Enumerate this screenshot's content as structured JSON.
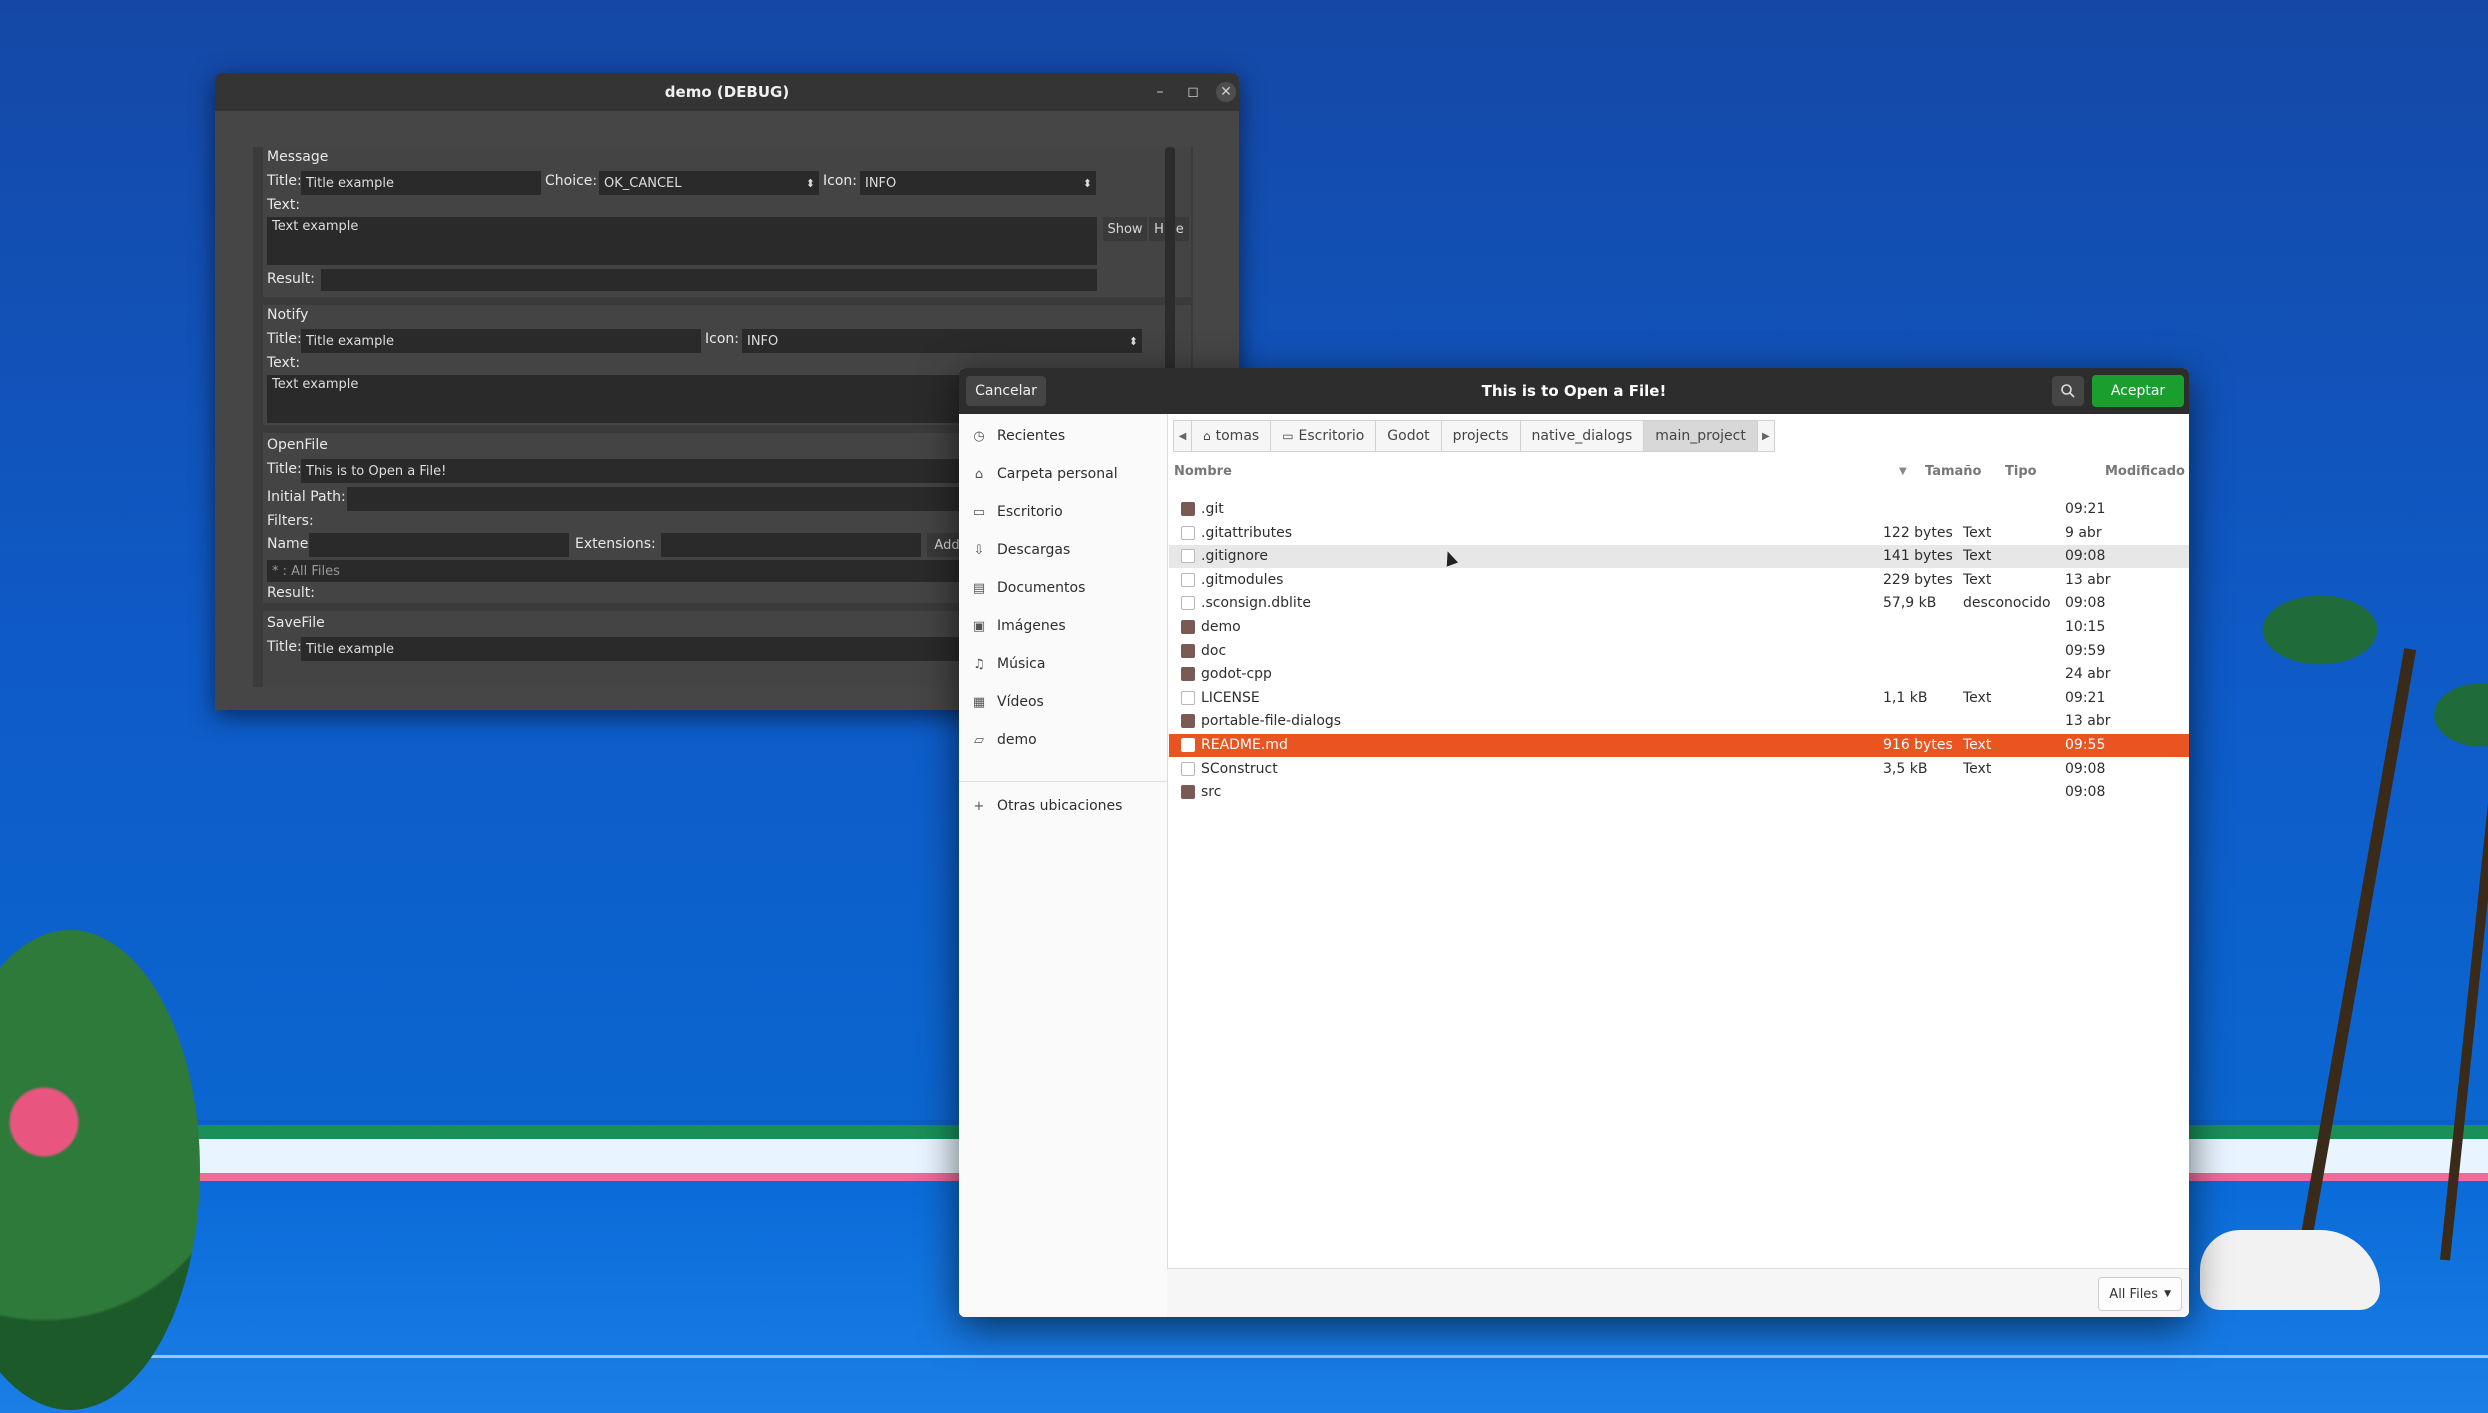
{
  "demo_window": {
    "title": "demo (DEBUG)",
    "controls": {
      "minimize": "–",
      "maximize": "◻",
      "close": "✕"
    },
    "message": {
      "header": "Message",
      "title_label": "Title:",
      "title_value": "Title example",
      "choice_label": "Choice:",
      "choice_value": "OK_CANCEL",
      "icon_label": "Icon:",
      "icon_value": "INFO",
      "text_label": "Text:",
      "text_value": "Text example",
      "show": "Show",
      "hide": "Hide",
      "result_label": "Result:"
    },
    "notify": {
      "header": "Notify",
      "title_label": "Title:",
      "title_value": "Title example",
      "icon_label": "Icon:",
      "icon_value": "INFO",
      "text_label": "Text:",
      "text_value": "Text example"
    },
    "openfile": {
      "header": "OpenFile",
      "title_label": "Title:",
      "title_value": "This is to Open a File!",
      "initial_path_label": "Initial Path:",
      "filters_label": "Filters:",
      "name_label": "Name:",
      "extensions_label": "Extensions:",
      "add": "Add",
      "filter_item": "* : All Files",
      "result_label": "Result:"
    },
    "savefile": {
      "header": "SaveFile",
      "title_label": "Title:",
      "title_value": "Title example"
    }
  },
  "file_chooser": {
    "title": "This is to Open a File!",
    "cancel": "Cancelar",
    "accept": "Aceptar",
    "accent_color": "#e95420",
    "accept_color": "#1a9f2e",
    "sidebar": [
      {
        "icon": "clock-icon",
        "glyph": "◷",
        "label": "Recientes"
      },
      {
        "icon": "home-icon",
        "glyph": "⌂",
        "label": "Carpeta personal"
      },
      {
        "icon": "desktop-icon",
        "glyph": "▭",
        "label": "Escritorio"
      },
      {
        "icon": "download-icon",
        "glyph": "⇩",
        "label": "Descargas"
      },
      {
        "icon": "document-icon",
        "glyph": "▤",
        "label": "Documentos"
      },
      {
        "icon": "image-icon",
        "glyph": "▣",
        "label": "Imágenes"
      },
      {
        "icon": "music-icon",
        "glyph": "♫",
        "label": "Música"
      },
      {
        "icon": "video-icon",
        "glyph": "▦",
        "label": "Vídeos"
      },
      {
        "icon": "folder-icon",
        "glyph": "▱",
        "label": "demo"
      }
    ],
    "other_locations": "Otras ubicaciones",
    "breadcrumbs": [
      "tomas",
      "Escritorio",
      "Godot",
      "projects",
      "native_dialogs",
      "main_project"
    ],
    "columns": {
      "name": "Nombre",
      "size": "Tamaño",
      "type": "Tipo",
      "modified": "Modificado"
    },
    "files": [
      {
        "name": ".git",
        "kind": "folder",
        "size": "",
        "type": "",
        "modified": "09:21"
      },
      {
        "name": ".gitattributes",
        "kind": "file",
        "size": "122 bytes",
        "type": "Text",
        "modified": "9 abr"
      },
      {
        "name": ".gitignore",
        "kind": "file",
        "size": "141 bytes",
        "type": "Text",
        "modified": "09:08"
      },
      {
        "name": ".gitmodules",
        "kind": "file",
        "size": "229 bytes",
        "type": "Text",
        "modified": "13 abr"
      },
      {
        "name": ".sconsign.dblite",
        "kind": "file",
        "size": "57,9 kB",
        "type": "desconocido",
        "modified": "09:08"
      },
      {
        "name": "demo",
        "kind": "folder",
        "size": "",
        "type": "",
        "modified": "10:15"
      },
      {
        "name": "doc",
        "kind": "folder",
        "size": "",
        "type": "",
        "modified": "09:59"
      },
      {
        "name": "godot-cpp",
        "kind": "folder",
        "size": "",
        "type": "",
        "modified": "24 abr"
      },
      {
        "name": "LICENSE",
        "kind": "file",
        "size": "1,1 kB",
        "type": "Text",
        "modified": "09:21"
      },
      {
        "name": "portable-file-dialogs",
        "kind": "folder",
        "size": "",
        "type": "",
        "modified": "13 abr"
      },
      {
        "name": "README.md",
        "kind": "file",
        "size": "916 bytes",
        "type": "Text",
        "modified": "09:55"
      },
      {
        "name": "SConstruct",
        "kind": "file",
        "size": "3,5 kB",
        "type": "Text",
        "modified": "09:08"
      },
      {
        "name": "src",
        "kind": "folder",
        "size": "",
        "type": "",
        "modified": "09:08"
      }
    ],
    "hover_index": 2,
    "selected_index": 10,
    "filter": "All Files"
  }
}
